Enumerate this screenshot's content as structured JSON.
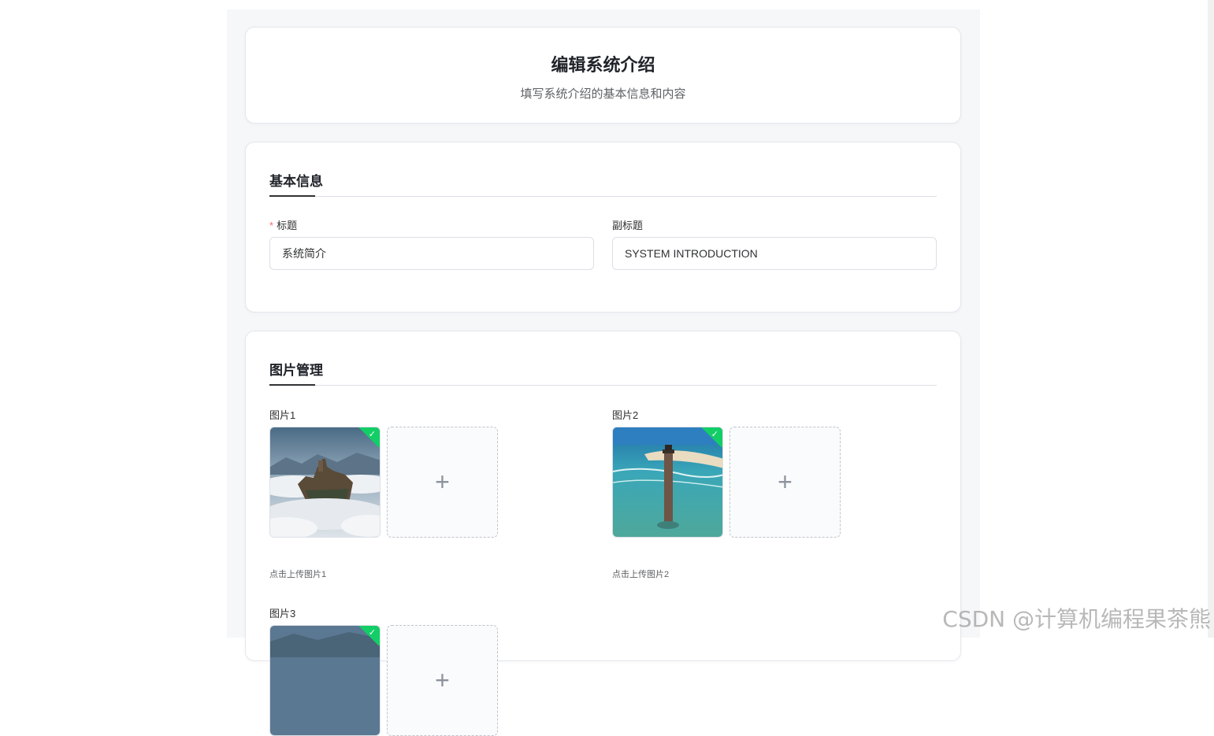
{
  "header": {
    "title": "编辑系统介绍",
    "subtitle": "填写系统介绍的基本信息和内容"
  },
  "basic_info": {
    "section_title": "基本信息",
    "title_field": {
      "label": "标题",
      "required_mark": "*",
      "value": "系统简介"
    },
    "subtitle_field": {
      "label": "副标题",
      "value": "SYSTEM INTRODUCTION"
    }
  },
  "images": {
    "section_title": "图片管理",
    "slots": [
      {
        "label": "图片1",
        "tip": "点击上传图片1",
        "image": "cliff-castle-in-clouds",
        "uploaded": true
      },
      {
        "label": "图片2",
        "tip": "点击上传图片2",
        "image": "lighthouse-in-sea",
        "uploaded": true
      },
      {
        "label": "图片3",
        "image": "cliff-castle-in-clouds",
        "uploaded": true
      }
    ],
    "add_icon": "plus-icon",
    "check_icon": "check-icon"
  },
  "watermark": "CSDN @计算机编程果茶熊",
  "colors": {
    "success": "#13ce66",
    "required": "#f56c6c",
    "border": "#dcdfe6",
    "page_bg": "#f5f7f9"
  }
}
